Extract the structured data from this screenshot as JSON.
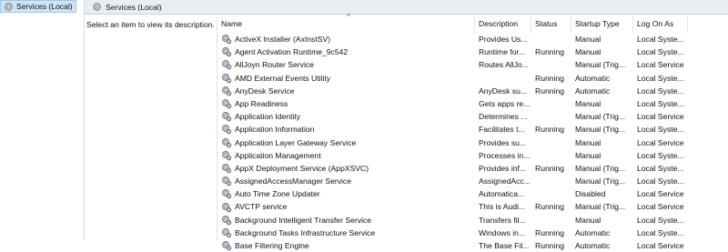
{
  "tree": {
    "item_label": "Services (Local)"
  },
  "header": {
    "title": "Services (Local)"
  },
  "description_pane": {
    "text": "Select an item to view its description."
  },
  "columns": {
    "name": "Name",
    "description": "Description",
    "status": "Status",
    "startup_type": "Startup Type",
    "log_on_as": "Log On As"
  },
  "services": [
    {
      "name": "ActiveX Installer (AxInstSV)",
      "description": "Provides Us...",
      "status": "",
      "startup_type": "Manual",
      "log_on_as": "Local Syste..."
    },
    {
      "name": "Agent Activation Runtime_9c542",
      "description": "Runtime for...",
      "status": "Running",
      "startup_type": "Manual",
      "log_on_as": "Local Syste..."
    },
    {
      "name": "AllJoyn Router Service",
      "description": "Routes AllJo...",
      "status": "",
      "startup_type": "Manual (Trig...",
      "log_on_as": "Local Service"
    },
    {
      "name": "AMD External Events Utility",
      "description": "",
      "status": "Running",
      "startup_type": "Automatic",
      "log_on_as": "Local Syste..."
    },
    {
      "name": "AnyDesk Service",
      "description": "AnyDesk su...",
      "status": "Running",
      "startup_type": "Automatic",
      "log_on_as": "Local Syste..."
    },
    {
      "name": "App Readiness",
      "description": "Gets apps re...",
      "status": "",
      "startup_type": "Manual",
      "log_on_as": "Local Syste..."
    },
    {
      "name": "Application Identity",
      "description": "Determines ...",
      "status": "",
      "startup_type": "Manual (Trig...",
      "log_on_as": "Local Service"
    },
    {
      "name": "Application Information",
      "description": "Facilitates t...",
      "status": "Running",
      "startup_type": "Manual (Trig...",
      "log_on_as": "Local Syste..."
    },
    {
      "name": "Application Layer Gateway Service",
      "description": "Provides su...",
      "status": "",
      "startup_type": "Manual",
      "log_on_as": "Local Service"
    },
    {
      "name": "Application Management",
      "description": "Processes in...",
      "status": "",
      "startup_type": "Manual",
      "log_on_as": "Local Syste..."
    },
    {
      "name": "AppX Deployment Service (AppXSVC)",
      "description": "Provides inf...",
      "status": "Running",
      "startup_type": "Manual (Trig...",
      "log_on_as": "Local Syste..."
    },
    {
      "name": "AssignedAccessManager Service",
      "description": "AssignedAcc...",
      "status": "",
      "startup_type": "Manual (Trig...",
      "log_on_as": "Local Syste..."
    },
    {
      "name": "Auto Time Zone Updater",
      "description": "Automatica...",
      "status": "",
      "startup_type": "Disabled",
      "log_on_as": "Local Service"
    },
    {
      "name": "AVCTP service",
      "description": "This is Audi...",
      "status": "Running",
      "startup_type": "Manual (Trig...",
      "log_on_as": "Local Service"
    },
    {
      "name": "Background Intelligent Transfer Service",
      "description": "Transfers fil...",
      "status": "",
      "startup_type": "Manual",
      "log_on_as": "Local Syste..."
    },
    {
      "name": "Background Tasks Infrastructure Service",
      "description": "Windows in...",
      "status": "Running",
      "startup_type": "Automatic",
      "log_on_as": "Local Syste..."
    },
    {
      "name": "Base Filtering Engine",
      "description": "The Base Fil...",
      "status": "Running",
      "startup_type": "Automatic",
      "log_on_as": "Local Service"
    }
  ]
}
